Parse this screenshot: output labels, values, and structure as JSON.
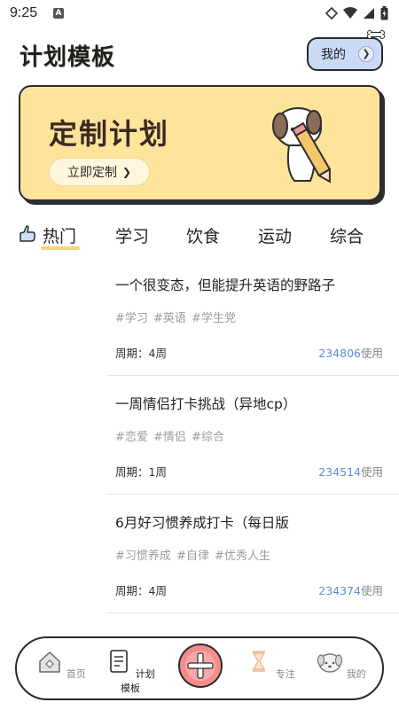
{
  "status_bar": {
    "time": "9:25",
    "notif_letter": "A"
  },
  "header": {
    "title": "计划模板",
    "mine_button": "我的"
  },
  "banner": {
    "title": "定制计划",
    "button_label": "立即定制"
  },
  "tabs": [
    {
      "label": "热门",
      "active": true
    },
    {
      "label": "学习",
      "active": false
    },
    {
      "label": "饮食",
      "active": false
    },
    {
      "label": "运动",
      "active": false
    },
    {
      "label": "综合",
      "active": false
    }
  ],
  "plans": [
    {
      "title": "一个很变态，但能提升英语的野路子",
      "tags": "#学习 #英语 #学生党",
      "period": "周期：4周",
      "uses": "234806",
      "uses_suffix": "使用"
    },
    {
      "title": "一周情侣打卡挑战（异地cp）",
      "tags": "#恋爱 #情侣 #综合",
      "period": "周期：1周",
      "uses": "234514",
      "uses_suffix": "使用"
    },
    {
      "title": "6月好习惯养成打卡（每日版",
      "tags": "#习惯养成 #自律 #优秀人生",
      "period": "周期：4周",
      "uses": "234374",
      "uses_suffix": "使用"
    }
  ],
  "bottom_nav": [
    {
      "label": "首页",
      "icon": "home-icon",
      "active": false
    },
    {
      "label": "计划模板",
      "icon": "template-icon",
      "active": true
    },
    {
      "label": "",
      "icon": "plus-icon",
      "active": false
    },
    {
      "label": "专注",
      "icon": "hourglass-icon",
      "active": false
    },
    {
      "label": "我的",
      "icon": "dog-face-icon",
      "active": false
    }
  ],
  "colors": {
    "banner_bg": "#fde49a",
    "accent_blue": "#5a8fd8",
    "center_button": "#f58c8c",
    "tab_underline": "#f6d37b"
  }
}
